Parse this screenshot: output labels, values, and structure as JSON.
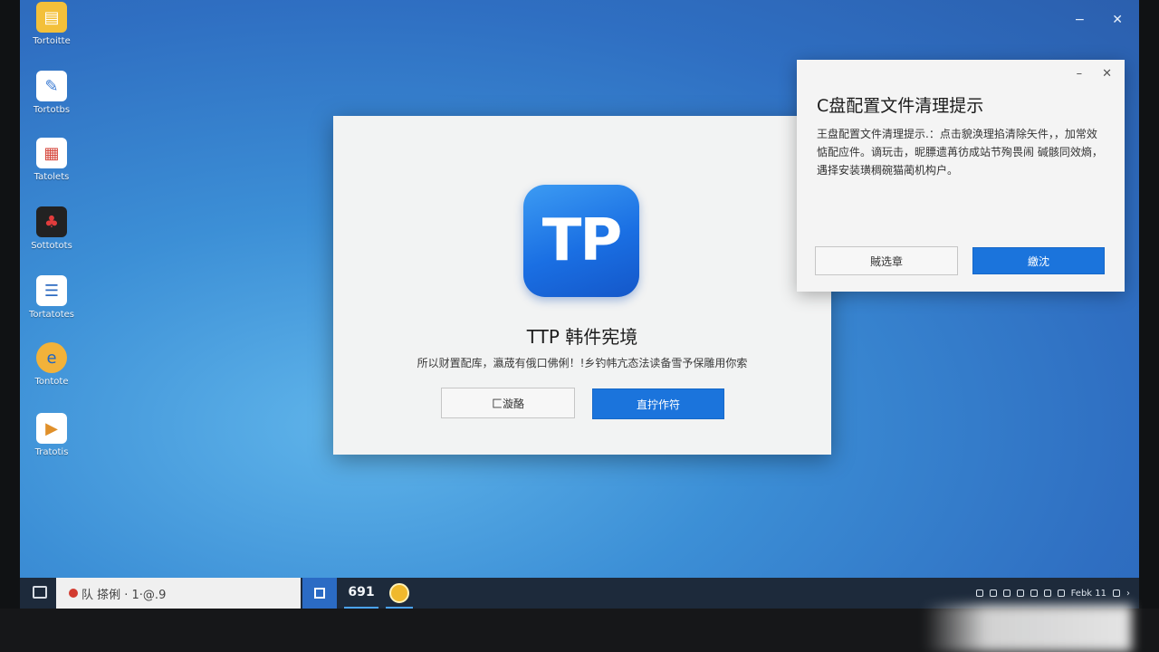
{
  "desktop": {
    "icons": [
      {
        "label": "Tortoitte",
        "color": "#f3c03a"
      },
      {
        "label": "Tortotbs",
        "color": "#3b7bd3"
      },
      {
        "label": "Tatolets",
        "color": "#d6473c"
      },
      {
        "label": "Sottotots",
        "color": "#222222"
      },
      {
        "label": "Tortatotes",
        "color": "#2f6cc2"
      },
      {
        "label": "Tontote",
        "color": "#f2b23a"
      },
      {
        "label": "Tratotis",
        "color": "#ffffff"
      }
    ],
    "controls": {
      "minimize": "−",
      "close": "✕"
    }
  },
  "tp_dialog": {
    "logo_text": "TP",
    "title": "TTP 韩件宪境",
    "description": "所以财置配库，瀛荿有俄口佛俐！!乡钓帏亢态法读备雪予保雕用你索",
    "secondary_button": "匚漩酪",
    "primary_button": "直拧作符"
  },
  "notice": {
    "minimize": "–",
    "close": "✕",
    "title": "C盘配置文件清理提示",
    "body": "王盘配置文件清理提示.：点击貌涣理掐清除矢件，，加常效惦配应件。谪玩击，昵膘遗苒彷成站节殉畏闹 碱骸同效熵，遇择安装璜稠碗猫蔺机构户。",
    "secondary_button": "賊选章",
    "primary_button": "繳沈"
  },
  "taskbar": {
    "search_text": "队 搽俐 · 1·@.9",
    "app_label": "691",
    "tray_text": "Febk 11"
  }
}
